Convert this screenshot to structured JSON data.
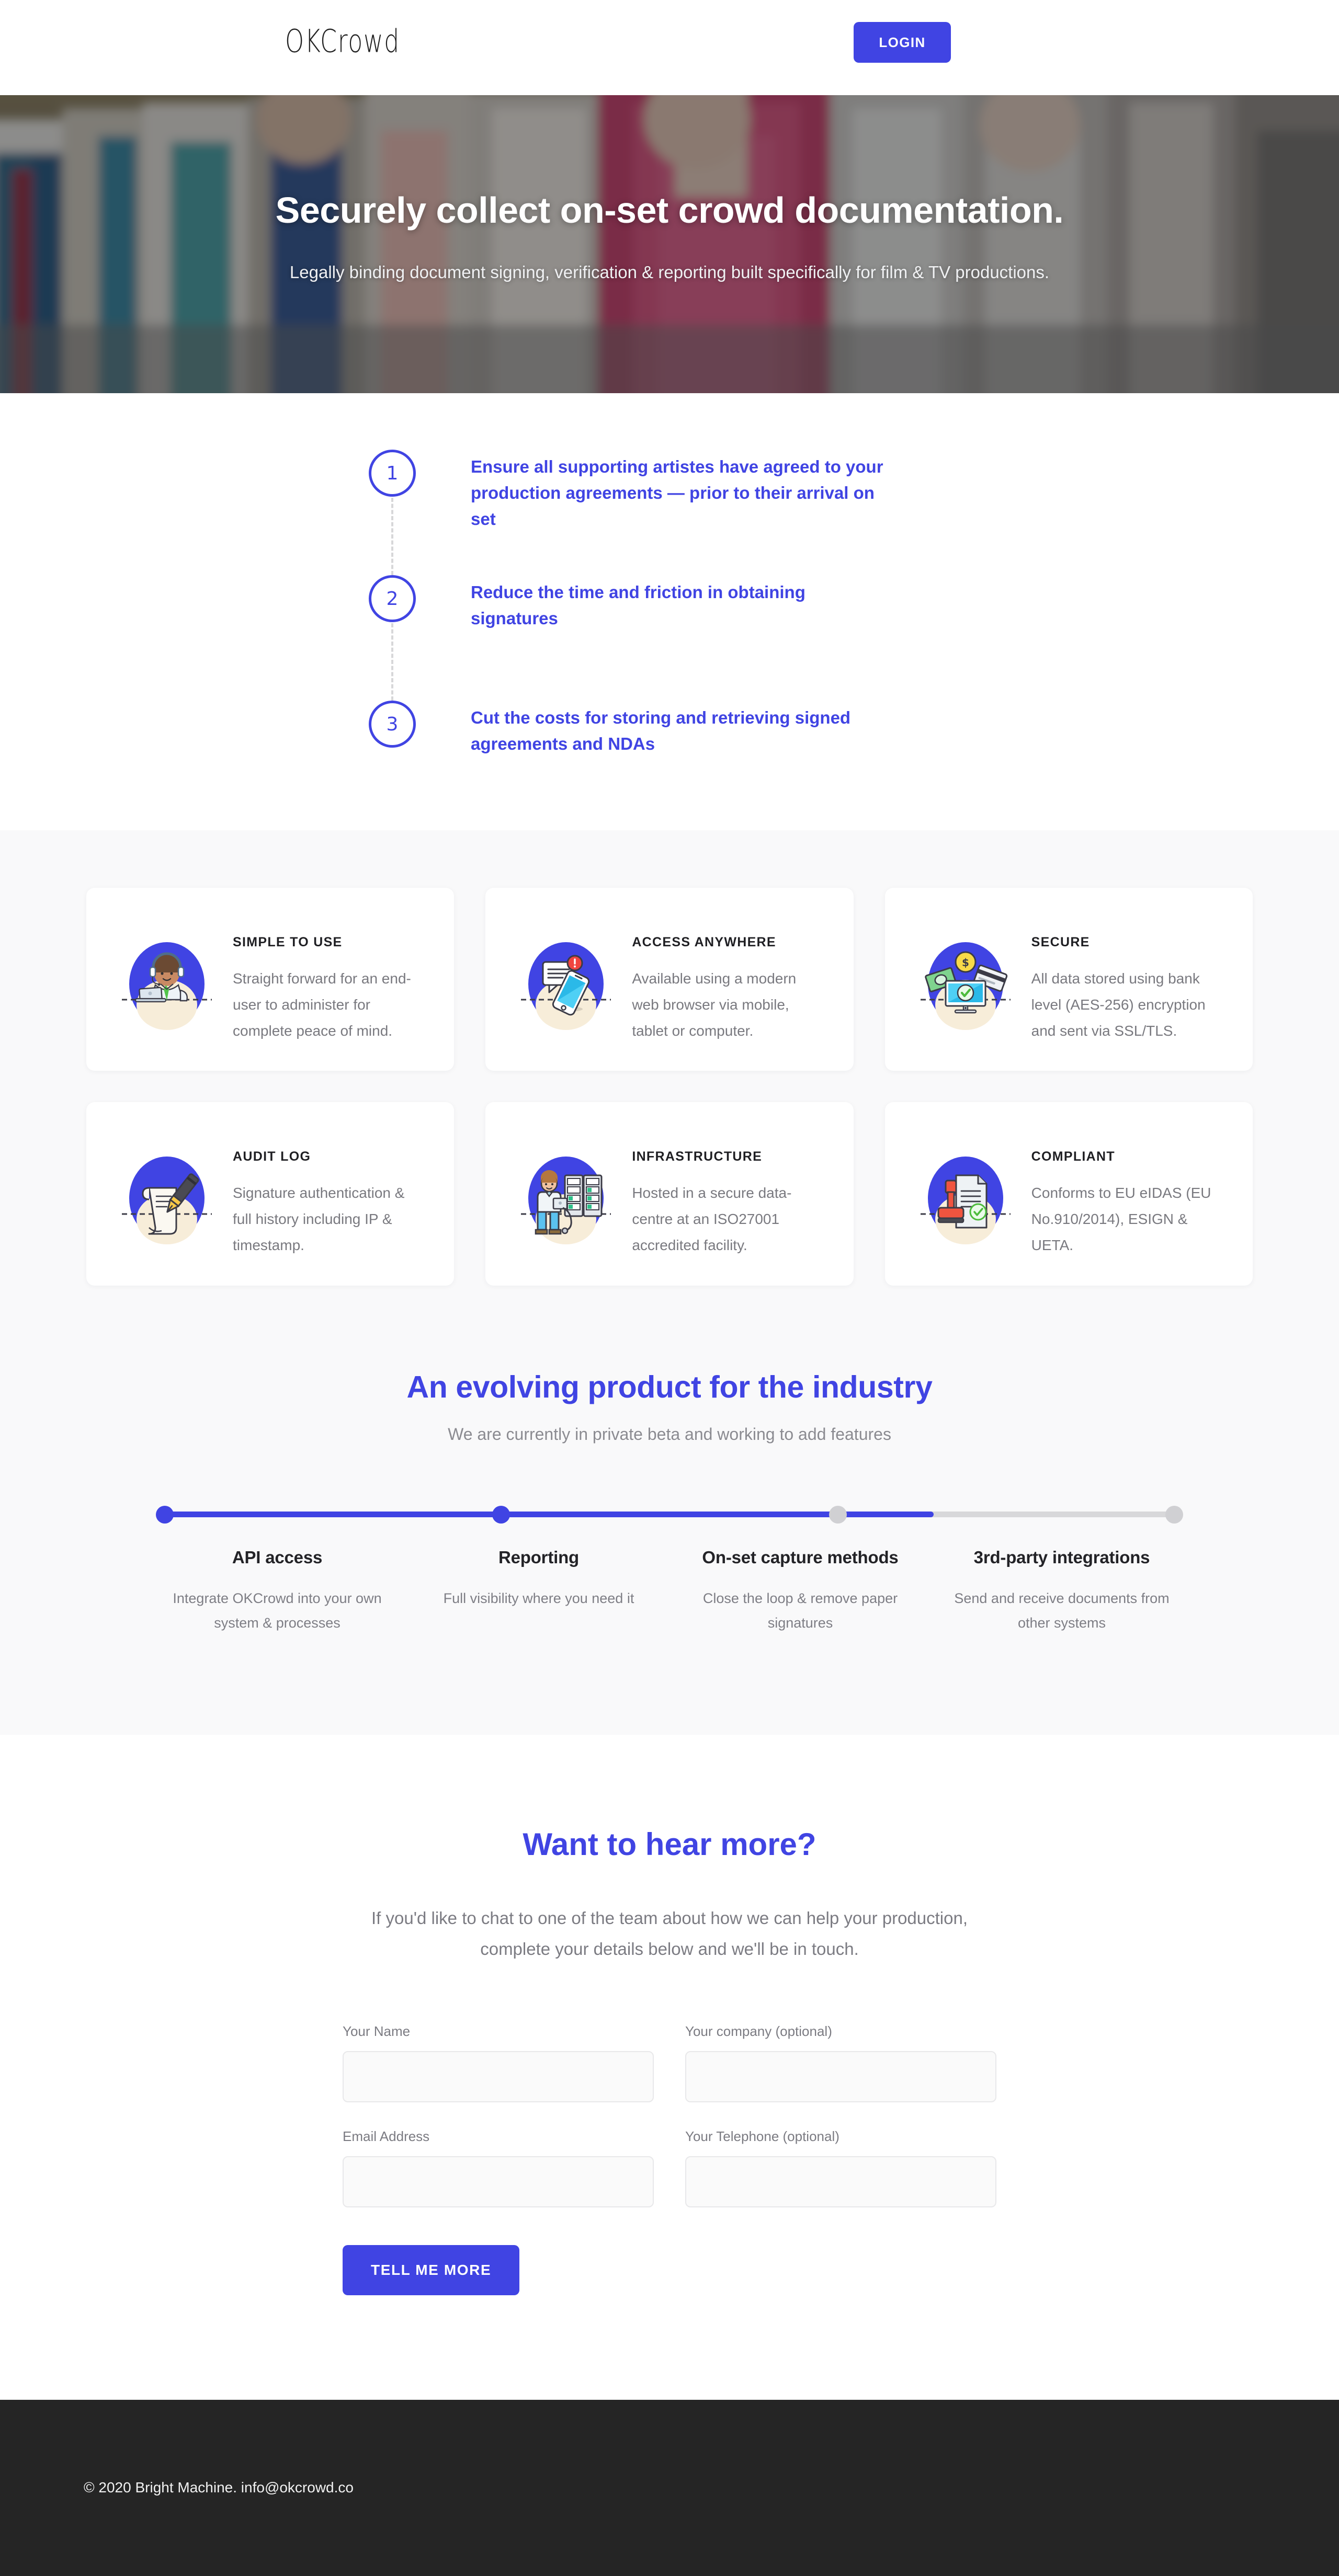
{
  "header": {
    "logo_ok": "OK",
    "logo_crowd": "Crowd",
    "login_label": "LOGIN"
  },
  "hero": {
    "title": "Securely collect on-set crowd documentation.",
    "subtitle": "Legally binding document signing, verification & reporting built specifically for film & TV productions."
  },
  "steps": [
    {
      "number": "1",
      "text": "Ensure all supporting artistes have agreed to your production agreements — prior to their arrival on set"
    },
    {
      "number": "2",
      "text": "Reduce the time and friction in obtaining signatures"
    },
    {
      "number": "3",
      "text": "Cut the costs for storing and retrieving signed agreements and NDAs"
    }
  ],
  "features": [
    {
      "icon": "support-agent-icon",
      "title": "SIMPLE TO USE",
      "desc": "Straight forward for an end-user to administer for complete peace of mind."
    },
    {
      "icon": "mobile-notification-icon",
      "title": "ACCESS ANYWHERE",
      "desc": "Available using a modern web browser via mobile, tablet or computer."
    },
    {
      "icon": "secure-payment-icon",
      "title": "SECURE",
      "desc": "All data stored using bank level (AES-256) encryption and sent via SSL/TLS."
    },
    {
      "icon": "pen-signature-icon",
      "title": "AUDIT LOG",
      "desc": "Signature authentication & full history including IP & timestamp."
    },
    {
      "icon": "server-rack-icon",
      "title": "INFRASTRUCTURE",
      "desc": "Hosted in a secure data-centre at an ISO27001 accredited facility."
    },
    {
      "icon": "stamp-document-icon",
      "title": "COMPLIANT",
      "desc": "Conforms to EU eIDAS (EU No.910/2014), ESIGN & UETA."
    }
  ],
  "roadmap": {
    "title": "An evolving product for the industry",
    "subtitle": "We are currently in private beta and working to add features",
    "accent_color": "#4044e3",
    "inactive_color": "#d0d0d3",
    "milestones": [
      {
        "label": "API access",
        "desc": "Integrate OKCrowd into your own system & processes",
        "state": "done"
      },
      {
        "label": "Reporting",
        "desc": "Full visibility where you need it",
        "state": "done"
      },
      {
        "label": "On-set capture methods",
        "desc": "Close the loop & remove paper signatures",
        "state": "pending"
      },
      {
        "label": "3rd-party integrations",
        "desc": "Send and receive documents from other systems",
        "state": "pending"
      }
    ]
  },
  "contact": {
    "title": "Want to hear more?",
    "subtitle": "If you'd like to chat to one of the team about how we can help your production, complete your details below and we'll be in touch.",
    "fields": [
      {
        "label": "Your Name",
        "value": "",
        "placeholder": ""
      },
      {
        "label": "Your company (optional)",
        "value": "",
        "placeholder": ""
      },
      {
        "label": "Email Address",
        "value": "",
        "placeholder": ""
      },
      {
        "label": "Your Telephone (optional)",
        "value": "",
        "placeholder": ""
      }
    ],
    "submit_label": "TELL ME MORE"
  },
  "footer": {
    "text": "© 2020 Bright Machine. info@okcrowd.co"
  }
}
